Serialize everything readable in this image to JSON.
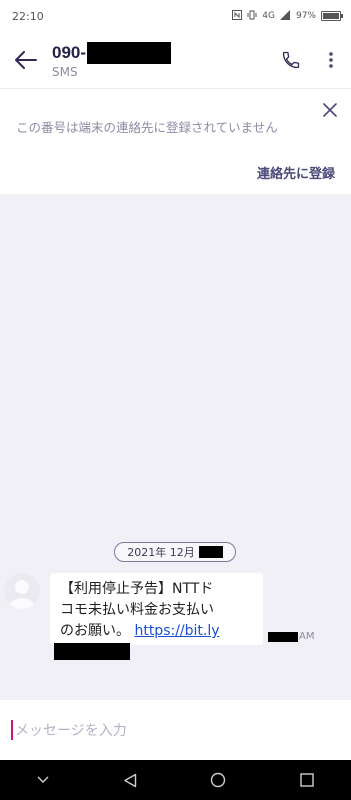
{
  "status_bar": {
    "time": "22:10",
    "network": "4G",
    "battery_text": "97%",
    "battery_level": 0.97
  },
  "app_bar": {
    "title_prefix": "090-",
    "title_redacted": true,
    "subtitle": "SMS",
    "icons": [
      "back-arrow-icon",
      "phone-icon",
      "more-vert-icon"
    ]
  },
  "banner": {
    "message": "この番号は端末の連絡先に登録されていません",
    "action_label": "連絡先に登録"
  },
  "conversation": {
    "date_label": "2021年 12月",
    "messages": [
      {
        "line1": "【利用停止予告】NTTド",
        "line2": "コモ未払い料金お支払い",
        "line3_text": "のお願い。",
        "link_text": "https://bit.ly",
        "time_suffix": "AM"
      }
    ]
  },
  "composer": {
    "placeholder": "メッセージを入力"
  },
  "nav_bar": {
    "icons": [
      "chevron-down-icon",
      "nav-back-icon",
      "nav-home-icon",
      "nav-recents-icon"
    ]
  },
  "colors": {
    "background": "#f1f0f7",
    "accent": "#4c4a78",
    "cursor": "#d1127a",
    "link": "#1a4fd4"
  }
}
